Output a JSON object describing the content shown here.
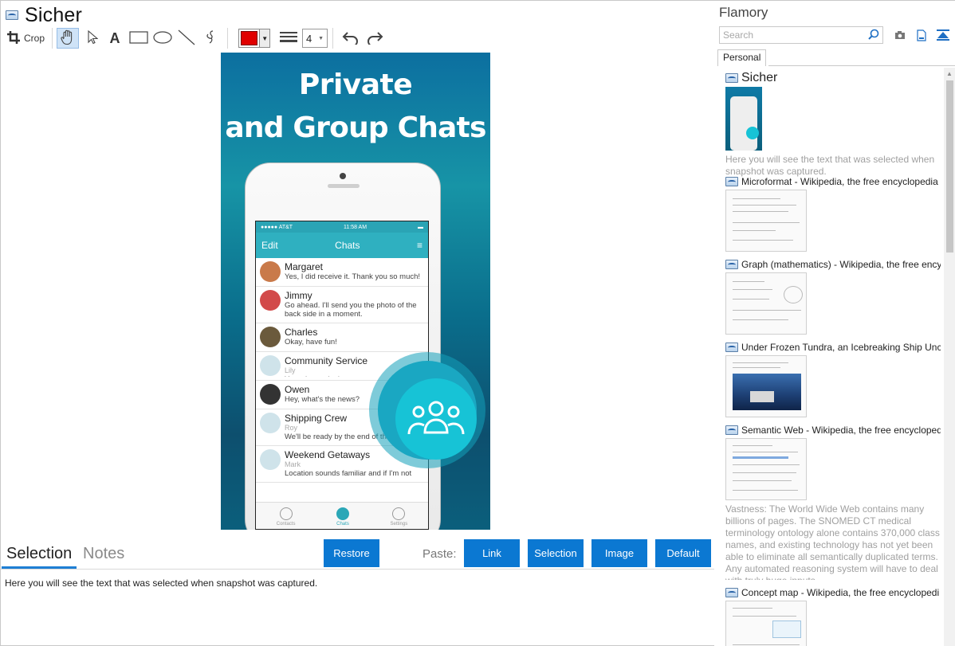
{
  "window": {
    "title": "Sicher"
  },
  "toolbar": {
    "crop_label": "Crop",
    "text_tool": "A",
    "line_width": "4",
    "color": "#e00000"
  },
  "screenshot": {
    "headline_1": "Private",
    "headline_2": "and Group Chats",
    "status_left": "●●●●● AT&T",
    "status_time": "11:58 AM",
    "nav_edit": "Edit",
    "nav_title": "Chats",
    "chats": [
      {
        "name": "Margaret",
        "sub": "",
        "text": "Yes, I did receive it. Thank you so much!",
        "color": "#c97a4a"
      },
      {
        "name": "Jimmy",
        "sub": "",
        "text": "Go ahead. I'll send you the photo of the back side in a moment.",
        "color": "#d24a4a"
      },
      {
        "name": "Charles",
        "sub": "",
        "text": "Okay, have fun!",
        "color": "#6b5a3c"
      },
      {
        "name": "Community Service",
        "sub": "Lily",
        "text": "Yes, please do :)",
        "color": "#cfe3ea"
      },
      {
        "name": "Owen",
        "sub": "",
        "text": "Hey, what's the news?",
        "color": "#333333"
      },
      {
        "name": "Shipping Crew",
        "sub": "Roy",
        "text": "We'll be ready by the end of th... Any special requests?",
        "color": "#cfe3ea"
      },
      {
        "name": "Weekend Getaways",
        "sub": "Mark",
        "text": "Location sounds familiar and if I'm not mistaken it's a beautiful place.",
        "color": "#cfe3ea"
      }
    ],
    "tabs": [
      "Contacts",
      "Chats",
      "Settings"
    ]
  },
  "bottom": {
    "tab_selection": "Selection",
    "tab_notes": "Notes",
    "restore_label": "Restore",
    "paste_label": "Paste:",
    "link_label": "Link",
    "selection_label": "Selection",
    "image_label": "Image",
    "default_label": "Default",
    "selection_text": "Here you will see the text that was selected when snapshot was captured."
  },
  "flamory": {
    "title": "Flamory",
    "search_placeholder": "Search",
    "tab_personal": "Personal",
    "entries": [
      {
        "title": "Sicher",
        "desc": "Here you will see the text that was selected when snapshot was captured."
      },
      {
        "title": "Microformat - Wikipedia, the free encyclopedia",
        "desc": ""
      },
      {
        "title": "Graph (mathematics) - Wikipedia, the free ency",
        "desc": ""
      },
      {
        "title": "Under Frozen Tundra, an Icebreaking Ship Unco",
        "desc": ""
      },
      {
        "title": "Semantic Web - Wikipedia, the free encycloped",
        "desc": "Vastness: The World Wide Web contains many billions of pages. The SNOMED CT medical terminology ontology alone contains 370,000 class names, and existing technology has not yet been able to eliminate all semantically duplicated terms. Any automated reasoning system will have to deal with truly huge inputs."
      },
      {
        "title": "Concept map - Wikipedia, the free encyclopedi",
        "desc": ""
      }
    ]
  }
}
